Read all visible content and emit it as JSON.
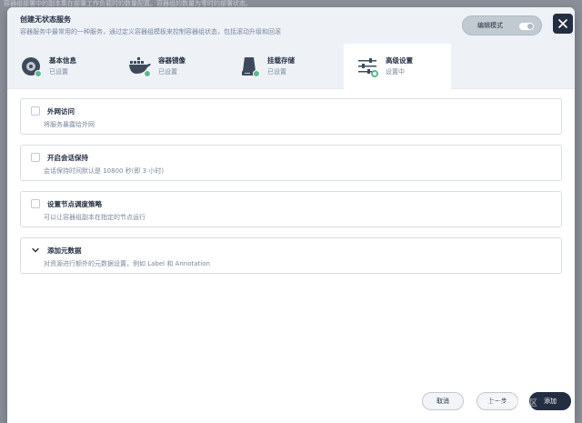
{
  "background_text": "容器组部署中的副本集在部署工作负载时的数量配置。容器组的数量为零时的部署状态。",
  "modal": {
    "title": "创建无状态服务",
    "description": "容器服务中最常用的一种服务，通过定义容器组模板来控制容器组状态，包括滚动升级和回滚",
    "edit_mode_label": "编辑模式",
    "close_icon": "close-icon"
  },
  "steps": [
    {
      "name": "基本信息",
      "status": "已设置",
      "icon": "info-icon",
      "active": false
    },
    {
      "name": "容器镜像",
      "status": "已设置",
      "icon": "docker-whale-icon",
      "active": false
    },
    {
      "name": "挂载存储",
      "status": "已设置",
      "icon": "storage-icon",
      "active": false
    },
    {
      "name": "高级设置",
      "status": "设置中",
      "icon": "sliders-icon",
      "active": true
    }
  ],
  "options": [
    {
      "title": "外网访问",
      "description": "将服务暴露给外网",
      "control": "checkbox"
    },
    {
      "title": "开启会话保持",
      "description": "会话保持时间默认是 10800 秒(即 3 小时)",
      "control": "checkbox"
    },
    {
      "title": "设置节点调度策略",
      "description": "可以让容器组副本在指定的节点运行",
      "control": "checkbox"
    },
    {
      "title": "添加元数据",
      "description": "对资源进行额外的元数据设置，例如 Label 和 Annotation",
      "control": "chevron"
    }
  ],
  "footer": {
    "cancel_label": "取消",
    "prev_label": "上一步",
    "add_label": "添加"
  },
  "watermark": "@掘金技术社区",
  "colors": {
    "accent_green": "#55bc8a",
    "dark": "#242e42",
    "header_bg": "#eef2f7"
  }
}
